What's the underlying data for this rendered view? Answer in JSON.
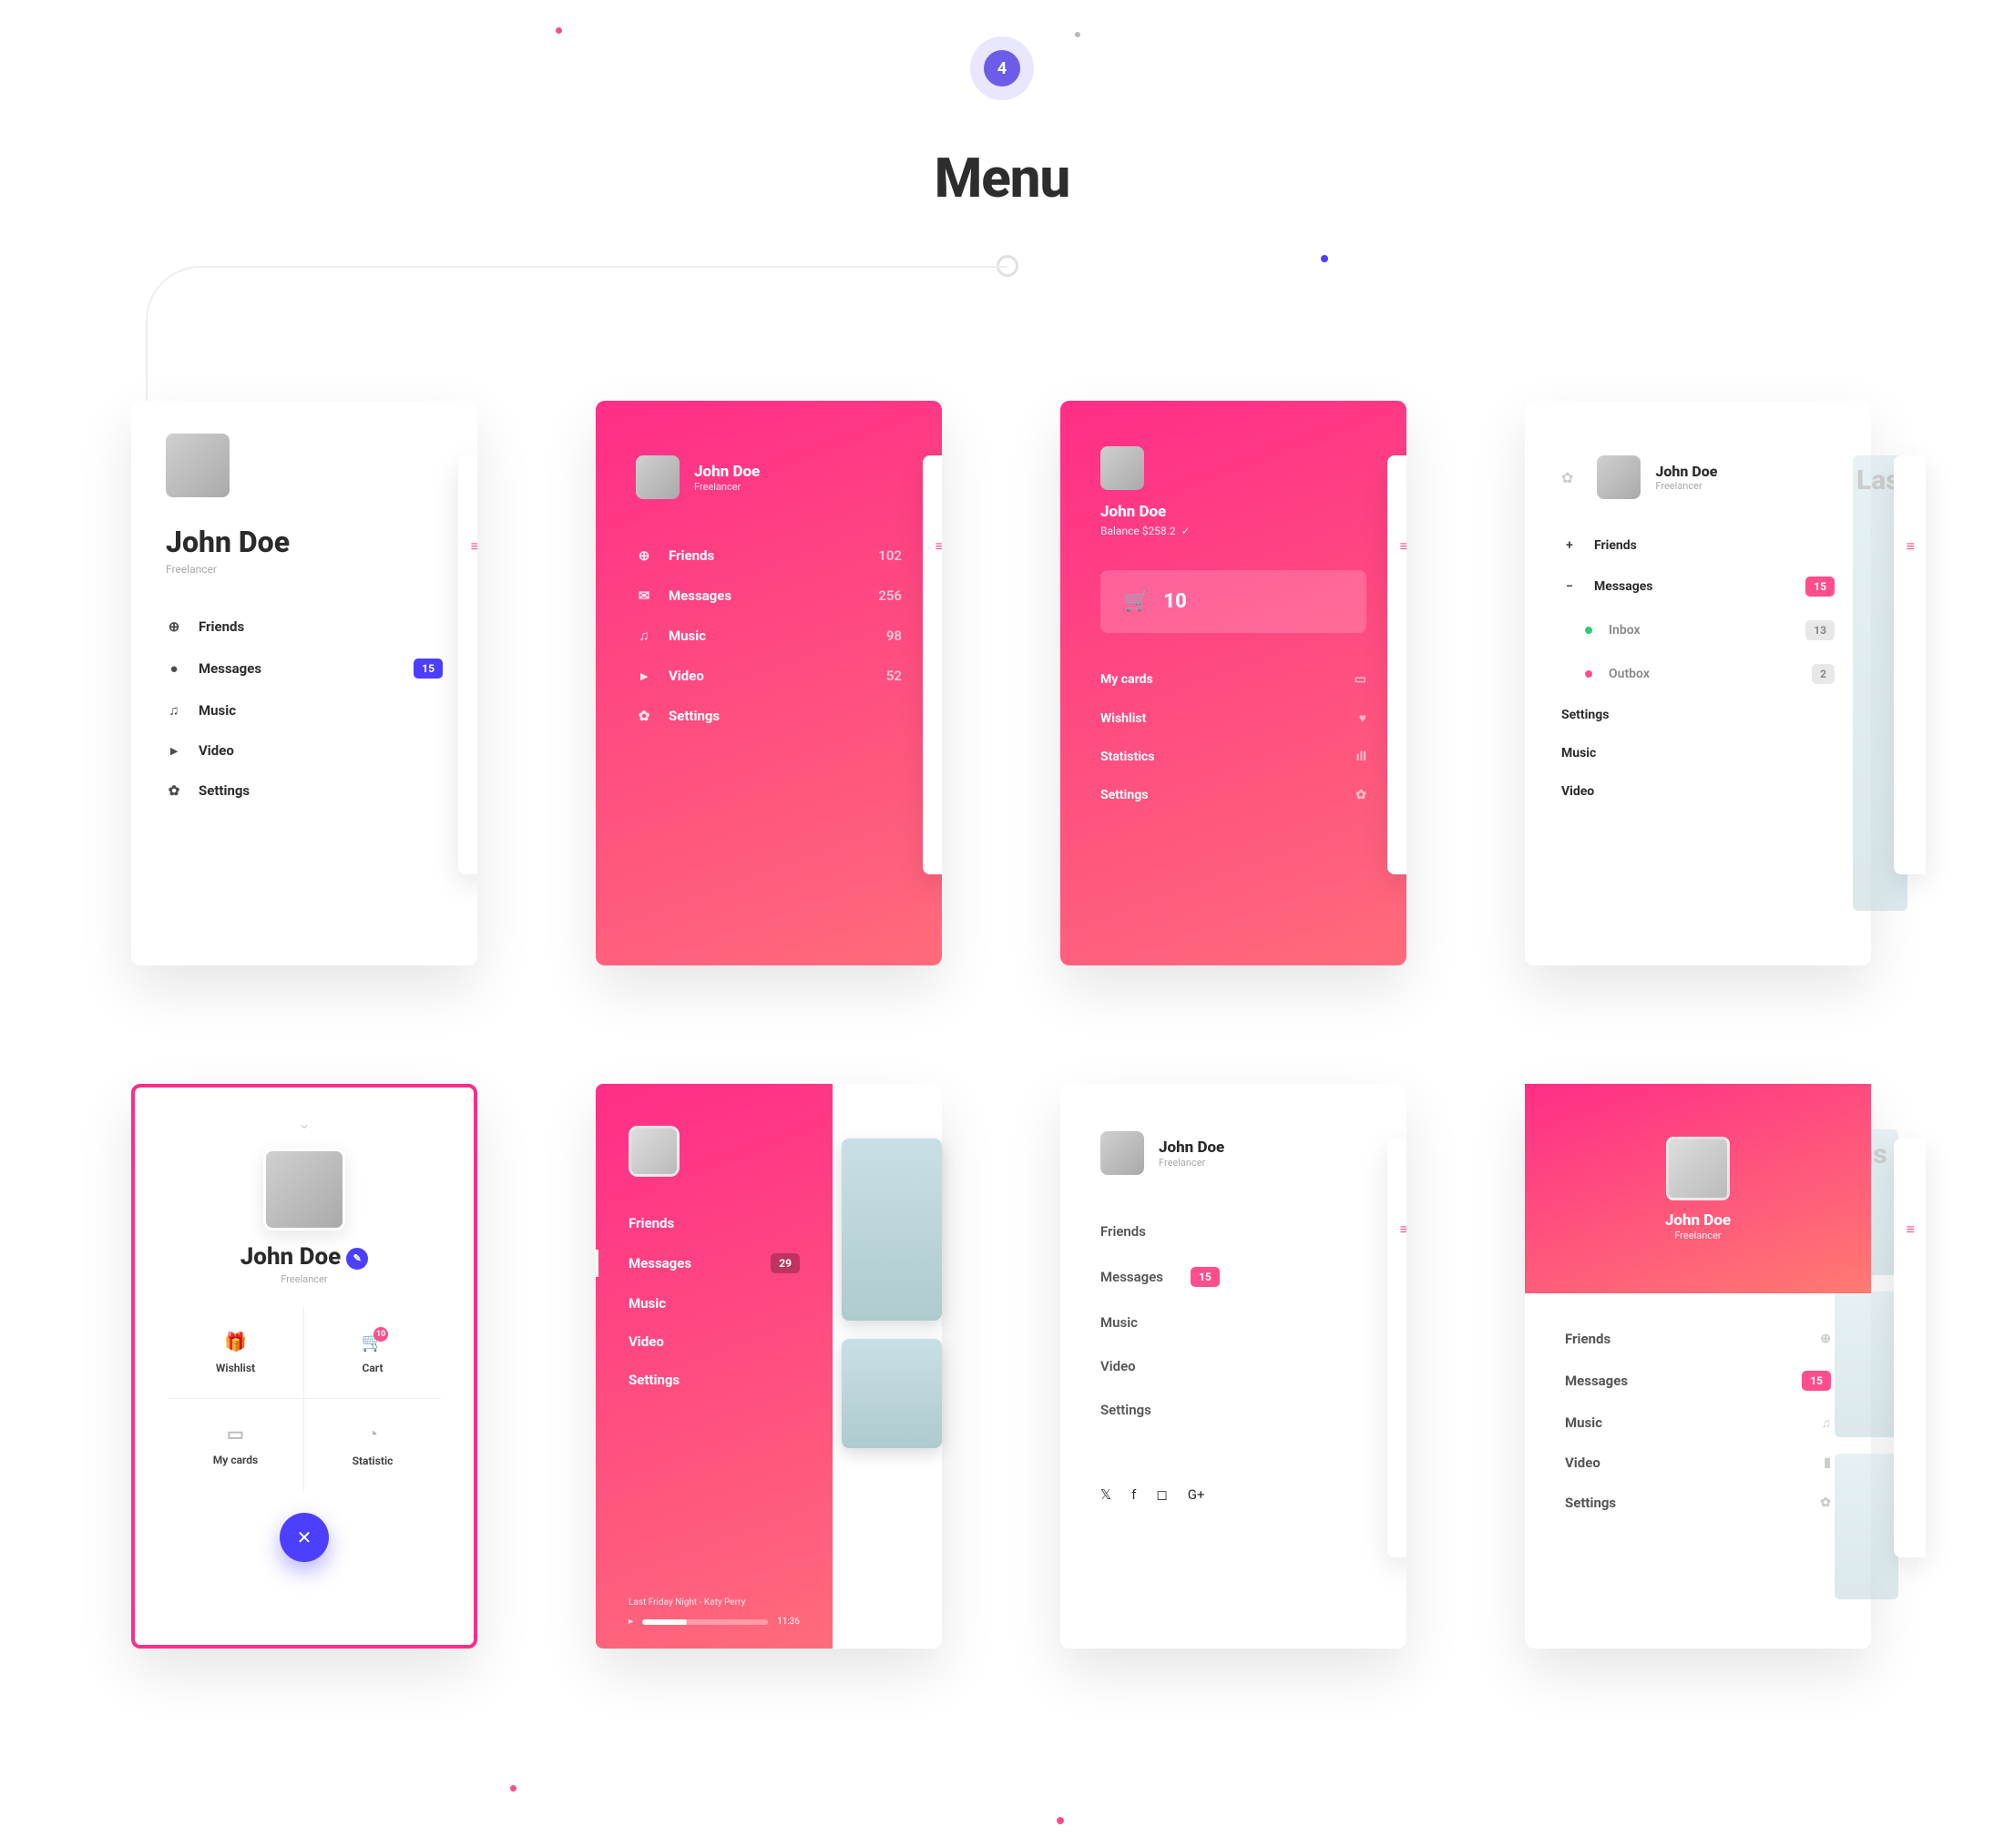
{
  "section": {
    "number": "4",
    "title": "Menu"
  },
  "user": {
    "name": "John Doe",
    "role": "Freelancer"
  },
  "colors": {
    "pink": "#ff4d8d",
    "blue": "#4c3fff",
    "purple": "#6c5ce7"
  },
  "card1": {
    "items": [
      {
        "label": "Friends"
      },
      {
        "label": "Messages",
        "badge": "15"
      },
      {
        "label": "Music"
      },
      {
        "label": "Video"
      },
      {
        "label": "Settings"
      }
    ]
  },
  "card2": {
    "items": [
      {
        "label": "Friends",
        "count": "102"
      },
      {
        "label": "Messages",
        "count": "256"
      },
      {
        "label": "Music",
        "count": "98"
      },
      {
        "label": "Video",
        "count": "52"
      },
      {
        "label": "Settings"
      }
    ]
  },
  "card3": {
    "balance_label": "Balance $258.2",
    "cart_count": "10",
    "items": [
      {
        "label": "My cards"
      },
      {
        "label": "Wishlist"
      },
      {
        "label": "Statistics"
      },
      {
        "label": "Settings"
      }
    ]
  },
  "card4": {
    "peek_heading": "Las",
    "items": [
      {
        "label": "Friends",
        "prefix": "+"
      },
      {
        "label": "Messages",
        "prefix": "−",
        "badge": "15",
        "badge_style": "pink"
      }
    ],
    "sub": [
      {
        "label": "Inbox",
        "dot": "#2ecc71",
        "badge": "13",
        "badge_style": "grey"
      },
      {
        "label": "Outbox",
        "dot": "#ff4d8d",
        "badge": "2",
        "badge_style": "grey"
      }
    ],
    "rest": [
      {
        "label": "Settings"
      },
      {
        "label": "Music"
      },
      {
        "label": "Video"
      }
    ]
  },
  "card5": {
    "cells": [
      {
        "label": "Wishlist"
      },
      {
        "label": "Cart",
        "bubble": "10"
      },
      {
        "label": "My cards"
      },
      {
        "label": "Statistic"
      }
    ]
  },
  "card6": {
    "items": [
      {
        "label": "Friends"
      },
      {
        "label": "Messages",
        "badge": "29",
        "active": true
      },
      {
        "label": "Music"
      },
      {
        "label": "Video"
      },
      {
        "label": "Settings"
      }
    ],
    "song": "Last Friday Night - Katy Perry",
    "time": "11:36"
  },
  "card7": {
    "items": [
      {
        "label": "Friends"
      },
      {
        "label": "Messages",
        "badge": "15"
      },
      {
        "label": "Music"
      },
      {
        "label": "Video"
      },
      {
        "label": "Settings"
      }
    ],
    "socials": [
      "twitter",
      "facebook",
      "instagram",
      "google-plus"
    ]
  },
  "card8": {
    "peek_heading": "Las",
    "items": [
      {
        "label": "Friends"
      },
      {
        "label": "Messages",
        "badge": "15"
      },
      {
        "label": "Music"
      },
      {
        "label": "Video"
      },
      {
        "label": "Settings"
      }
    ]
  }
}
